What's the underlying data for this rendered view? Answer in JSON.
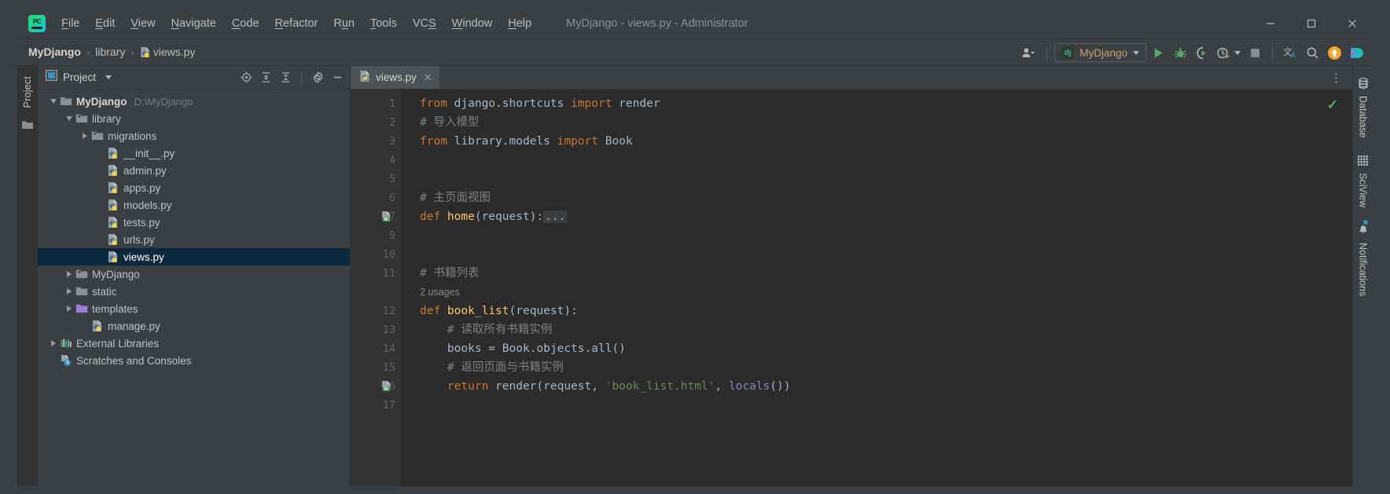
{
  "window": {
    "title": "MyDjango - views.py - Administrator",
    "minimize_label": "—",
    "maximize_label": "□",
    "close_label": "✕"
  },
  "menubar": {
    "items": [
      {
        "label": "File",
        "mnemonic": "F"
      },
      {
        "label": "Edit",
        "mnemonic": "E"
      },
      {
        "label": "View",
        "mnemonic": "V"
      },
      {
        "label": "Navigate",
        "mnemonic": "N"
      },
      {
        "label": "Code",
        "mnemonic": "C"
      },
      {
        "label": "Refactor",
        "mnemonic": "R"
      },
      {
        "label": "Run",
        "mnemonic": "u"
      },
      {
        "label": "Tools",
        "mnemonic": "T"
      },
      {
        "label": "VCS",
        "mnemonic": "S"
      },
      {
        "label": "Window",
        "mnemonic": "W"
      },
      {
        "label": "Help",
        "mnemonic": "H"
      }
    ]
  },
  "breadcrumb": {
    "items": [
      "MyDjango",
      "library",
      "views.py"
    ],
    "separator": "›"
  },
  "toolbar": {
    "run_config_name": "MyDjango",
    "run_config_icon_text": "dj",
    "run_label": "Run",
    "debug_label": "Debug",
    "coverage_label": "Run with Coverage",
    "profile_label": "Profile",
    "stop_label": "Stop",
    "translate_label": "Translate",
    "search_label": "Search Everywhere",
    "update_label": "Update",
    "plugin_label": "Plugin"
  },
  "left_strip": {
    "project_tab": "Project"
  },
  "project_panel": {
    "title": "Project",
    "actions": [
      "locate-icon",
      "expand-all-icon",
      "collapse-all-icon",
      "settings-icon",
      "hide-icon"
    ],
    "tree": [
      {
        "label": "MyDjango",
        "path": "D:\\MyDjango",
        "indent": 0,
        "arrow": "open",
        "icon": "folder-root",
        "bold": true
      },
      {
        "label": "library",
        "indent": 1,
        "arrow": "open",
        "icon": "folder-module"
      },
      {
        "label": "migrations",
        "indent": 2,
        "arrow": "closed",
        "icon": "folder-module"
      },
      {
        "label": "__init__.py",
        "indent": 3,
        "arrow": "none",
        "icon": "python-file"
      },
      {
        "label": "admin.py",
        "indent": 3,
        "arrow": "none",
        "icon": "python-file"
      },
      {
        "label": "apps.py",
        "indent": 3,
        "arrow": "none",
        "icon": "python-file"
      },
      {
        "label": "models.py",
        "indent": 3,
        "arrow": "none",
        "icon": "python-file"
      },
      {
        "label": "tests.py",
        "indent": 3,
        "arrow": "none",
        "icon": "python-file"
      },
      {
        "label": "urls.py",
        "indent": 3,
        "arrow": "none",
        "icon": "python-file"
      },
      {
        "label": "views.py",
        "indent": 3,
        "arrow": "none",
        "icon": "python-file",
        "selected": true
      },
      {
        "label": "MyDjango",
        "indent": 1,
        "arrow": "closed",
        "icon": "folder-module"
      },
      {
        "label": "static",
        "indent": 1,
        "arrow": "closed",
        "icon": "folder-plain"
      },
      {
        "label": "templates",
        "indent": 1,
        "arrow": "closed",
        "icon": "folder-templates"
      },
      {
        "label": "manage.py",
        "indent": 2,
        "arrow": "none",
        "icon": "python-file"
      },
      {
        "label": "External Libraries",
        "indent": 0,
        "arrow": "closed",
        "icon": "libraries"
      },
      {
        "label": "Scratches and Consoles",
        "indent": 0,
        "arrow": "none",
        "icon": "scratches"
      }
    ]
  },
  "editor": {
    "tab": {
      "label": "views.py",
      "icon": "python-file",
      "close": "✕"
    },
    "options_label": "⋮",
    "inspection_status": "✓",
    "lines": [
      {
        "num": "1",
        "fold": "fold-start",
        "tokens": [
          {
            "t": "from ",
            "c": "k"
          },
          {
            "t": "django.shortcuts ",
            "c": "tx"
          },
          {
            "t": "import ",
            "c": "k"
          },
          {
            "t": "render",
            "c": "tx"
          }
        ]
      },
      {
        "num": "2",
        "tokens": [
          {
            "t": "# 导入模型",
            "c": "cm"
          }
        ]
      },
      {
        "num": "3",
        "fold": "fold-end",
        "tokens": [
          {
            "t": "from ",
            "c": "k"
          },
          {
            "t": "library.models ",
            "c": "tx"
          },
          {
            "t": "import ",
            "c": "k"
          },
          {
            "t": "Book",
            "c": "tx"
          }
        ]
      },
      {
        "num": "4",
        "tokens": []
      },
      {
        "num": "5",
        "tokens": []
      },
      {
        "num": "6",
        "tokens": [
          {
            "t": "# 主页面视图",
            "c": "cm"
          }
        ]
      },
      {
        "num": "7",
        "gutter_icon": "django-html-icon",
        "fold": "collapsed",
        "tokens": [
          {
            "t": "def ",
            "c": "k"
          },
          {
            "t": "home",
            "c": "fn"
          },
          {
            "t": "(request):",
            "c": "tx"
          },
          {
            "t": "...",
            "c": "ellipsis"
          }
        ]
      },
      {
        "num": "9",
        "tokens": []
      },
      {
        "num": "10",
        "tokens": []
      },
      {
        "num": "11",
        "tokens": [
          {
            "t": "# 书籍列表",
            "c": "cm"
          }
        ]
      },
      {
        "num": "",
        "inlay": "2 usages"
      },
      {
        "num": "12",
        "fold": "fold-start",
        "tokens": [
          {
            "t": "def ",
            "c": "k"
          },
          {
            "t": "book_list",
            "c": "fn"
          },
          {
            "t": "(request):",
            "c": "tx"
          }
        ]
      },
      {
        "num": "13",
        "tokens": [
          {
            "t": "    # 读取所有书籍实例",
            "c": "cm"
          }
        ]
      },
      {
        "num": "14",
        "tokens": [
          {
            "t": "    books = Book.objects.all()",
            "c": "tx"
          }
        ]
      },
      {
        "num": "15",
        "tokens": [
          {
            "t": "    # 返回页面与书籍实例",
            "c": "cm"
          }
        ]
      },
      {
        "num": "16",
        "gutter_icon": "django-html-icon",
        "fold": "fold-end",
        "tokens": [
          {
            "t": "    ",
            "c": "tx"
          },
          {
            "t": "return ",
            "c": "k"
          },
          {
            "t": "render(request, ",
            "c": "tx"
          },
          {
            "t": "'book_list.html'",
            "c": "st"
          },
          {
            "t": ", ",
            "c": "tx"
          },
          {
            "t": "locals",
            "c": "bi"
          },
          {
            "t": "())",
            "c": "tx"
          }
        ]
      },
      {
        "num": "17",
        "tokens": []
      }
    ]
  },
  "right_strip": {
    "tabs": [
      {
        "label": "Database",
        "icon": "database-icon"
      },
      {
        "label": "SciView",
        "icon": "grid-icon"
      },
      {
        "label": "Notifications",
        "icon": "bell-icon",
        "badge": true
      }
    ]
  },
  "colors": {
    "background": "#3c3f41",
    "editor_bg": "#2b2b2b",
    "gutter_bg": "#313335",
    "selection": "#0d293e",
    "keyword": "#cc7832",
    "function": "#ffc66d",
    "comment": "#808080",
    "string": "#6a8759",
    "text": "#a9b7c6",
    "accent_green": "#59a869"
  }
}
